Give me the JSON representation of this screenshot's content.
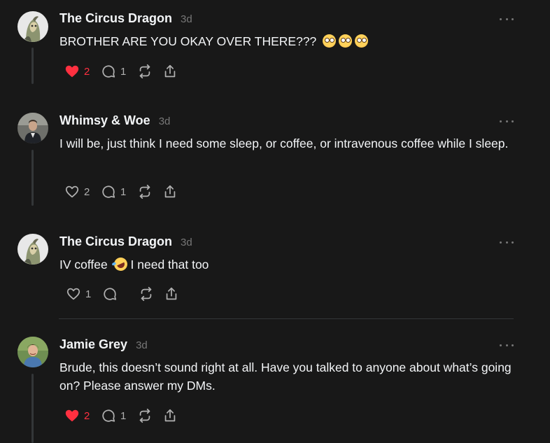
{
  "colors": {
    "background": "#181818",
    "text": "#f3f5f7",
    "muted": "#777777",
    "like_active": "#ff3040",
    "thread_line": "#333638"
  },
  "posts": [
    {
      "username": "The Circus Dragon",
      "time": "3d",
      "text": "BROTHER ARE YOU OKAY OVER THERE???",
      "emojis": [
        "flushed-face",
        "flushed-face",
        "flushed-face"
      ],
      "likes": "2",
      "liked": true,
      "replies": "1",
      "reposts": "",
      "shares": ""
    },
    {
      "username": "Whimsy & Woe",
      "time": "3d",
      "text": "I will be, just think I need some sleep, or coffee, or intravenous coffee while I sleep.",
      "likes": "2",
      "liked": false,
      "replies": "1",
      "reposts": "",
      "shares": ""
    },
    {
      "username": "The Circus Dragon",
      "time": "3d",
      "text_before": "IV coffee",
      "emoji": "rolling-on-floor-laughing-face",
      "text_after": "I need that too",
      "likes": "1",
      "liked": false,
      "replies": "",
      "reposts": "",
      "shares": ""
    },
    {
      "username": "Jamie Grey",
      "time": "3d",
      "text": "Brude, this doesn’t sound right at all. Have you talked to anyone about what’s going on? Please answer my DMs.",
      "likes": "2",
      "liked": true,
      "replies": "1",
      "reposts": "",
      "shares": ""
    }
  ]
}
